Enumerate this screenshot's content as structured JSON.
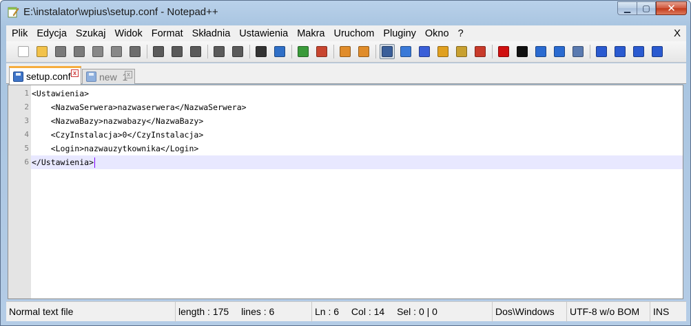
{
  "window": {
    "title": "E:\\instalator\\wpius\\setup.conf - Notepad++"
  },
  "caption_buttons": {
    "minimize": "▁",
    "maximize": "▢",
    "close": "✕"
  },
  "menu": {
    "items": [
      "Plik",
      "Edycja",
      "Szukaj",
      "Widok",
      "Format",
      "Składnia",
      "Ustawienia",
      "Makra",
      "Uruchom",
      "Pluginy",
      "Okno",
      "?"
    ],
    "close_label": "X"
  },
  "toolbar": {
    "buttons": [
      {
        "icon": "new-file-icon",
        "color": "#ffffff"
      },
      {
        "icon": "open-file-icon",
        "color": "#f2c24a"
      },
      {
        "icon": "save-icon",
        "color": "#7a7a7a"
      },
      {
        "icon": "save-all-icon",
        "color": "#7a7a7a"
      },
      {
        "icon": "close-icon",
        "color": "#888888"
      },
      {
        "icon": "close-all-icon",
        "color": "#888888"
      },
      {
        "icon": "print-icon",
        "color": "#6d6d6d"
      },
      {
        "sep": true
      },
      {
        "icon": "cut-icon",
        "color": "#5a5a5a"
      },
      {
        "icon": "copy-icon",
        "color": "#5a5a5a"
      },
      {
        "icon": "paste-icon",
        "color": "#5a5a5a"
      },
      {
        "sep": true
      },
      {
        "icon": "undo-icon",
        "color": "#5a5a5a"
      },
      {
        "icon": "redo-icon",
        "color": "#5a5a5a"
      },
      {
        "sep": true
      },
      {
        "icon": "find-icon",
        "color": "#333333"
      },
      {
        "icon": "replace-icon",
        "color": "#2f6fc7"
      },
      {
        "sep": true
      },
      {
        "icon": "zoom-in-icon",
        "color": "#3a9a3a"
      },
      {
        "icon": "zoom-out-icon",
        "color": "#c8452f"
      },
      {
        "sep": true
      },
      {
        "icon": "sync-vertical-icon",
        "color": "#e08c2a"
      },
      {
        "icon": "sync-horizontal-icon",
        "color": "#e08c2a"
      },
      {
        "sep": true
      },
      {
        "icon": "word-wrap-icon",
        "color": "#3a5f9a",
        "pressed": true
      },
      {
        "icon": "show-all-chars-icon",
        "color": "#3a7ad8"
      },
      {
        "icon": "indent-guide-icon",
        "color": "#3a5fd8"
      },
      {
        "icon": "user-lang-icon",
        "color": "#e0a020"
      },
      {
        "icon": "doc-map-icon",
        "color": "#c8a030"
      },
      {
        "icon": "function-list-icon",
        "color": "#c83a2a"
      },
      {
        "sep": true
      },
      {
        "icon": "record-macro-icon",
        "color": "#d01010"
      },
      {
        "icon": "stop-macro-icon",
        "color": "#111111"
      },
      {
        "icon": "play-macro-icon",
        "color": "#2a6ad0"
      },
      {
        "icon": "run-macro-multiple-icon",
        "color": "#2a6ad0"
      },
      {
        "icon": "save-macro-icon",
        "color": "#5a7ab0"
      },
      {
        "sep": true
      },
      {
        "icon": "fold-all-icon",
        "color": "#2a5ad0"
      },
      {
        "icon": "prev-bookmark-icon",
        "color": "#2a5ad0"
      },
      {
        "icon": "next-bookmark-icon",
        "color": "#2a5ad0"
      },
      {
        "icon": "unfold-all-icon",
        "color": "#2a5ad0"
      }
    ]
  },
  "tabs": [
    {
      "label": "setup.conf",
      "active": true
    },
    {
      "label": "new  1",
      "active": false
    }
  ],
  "editor": {
    "line_numbers": [
      "1",
      "2",
      "3",
      "4",
      "5",
      "6"
    ],
    "lines": [
      "<Ustawienia>",
      "    <NazwaSerwera>nazwaserwera</NazwaSerwera>",
      "    <NazwaBazy>nazwabazy</NazwaBazy>",
      "    <CzyInstalacja>0</CzyInstalacja>",
      "    <Login>nazwauzytkownika</Login>",
      "</Ustawienia>"
    ],
    "current_line": 6
  },
  "status": {
    "file_type": "Normal text file",
    "length": "length : 175",
    "lines": "lines : 6",
    "ln": "Ln : 6",
    "col": "Col : 14",
    "sel": "Sel : 0 | 0",
    "eol": "Dos\\Windows",
    "encoding": "UTF-8 w/o BOM",
    "mode": "INS"
  }
}
